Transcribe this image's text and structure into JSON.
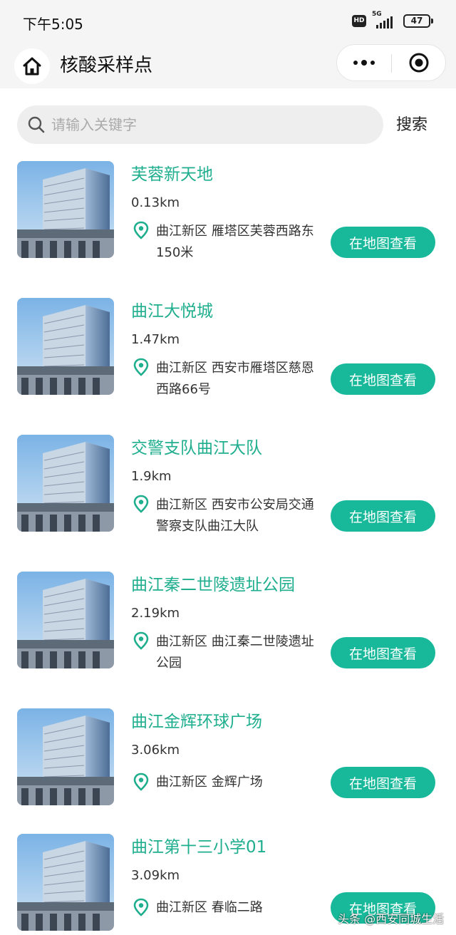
{
  "status_bar": {
    "time": "下午5:05",
    "hd_badge": "HD",
    "network": "5G",
    "battery": "47"
  },
  "nav": {
    "title": "核酸采样点"
  },
  "search": {
    "placeholder": "请输入关键字",
    "value": "",
    "button_label": "搜索"
  },
  "colors": {
    "accent": "#1fae8e",
    "button": "#17b99a"
  },
  "sites": [
    {
      "name": "芙蓉新天地",
      "distance": "0.13km",
      "address": "曲江新区 雁塔区芙蓉西路东150米",
      "button": "在地图查看"
    },
    {
      "name": "曲江大悦城",
      "distance": "1.47km",
      "address": "曲江新区 西安市雁塔区慈恩西路66号",
      "button": "在地图查看"
    },
    {
      "name": "交警支队曲江大队",
      "distance": "1.9km",
      "address": "曲江新区 西安市公安局交通警察支队曲江大队",
      "button": "在地图查看"
    },
    {
      "name": "曲江秦二世陵遗址公园",
      "distance": "2.19km",
      "address": "曲江新区 曲江秦二世陵遗址公园",
      "button": "在地图查看"
    },
    {
      "name": "曲江金辉环球广场",
      "distance": "3.06km",
      "address": "曲江新区 金辉广场",
      "button": "在地图查看"
    },
    {
      "name": "曲江第十三小学01",
      "distance": "3.09km",
      "address": "曲江新区 春临二路",
      "button": "在地图查看"
    }
  ],
  "watermark": "头条 @西安同城生活"
}
